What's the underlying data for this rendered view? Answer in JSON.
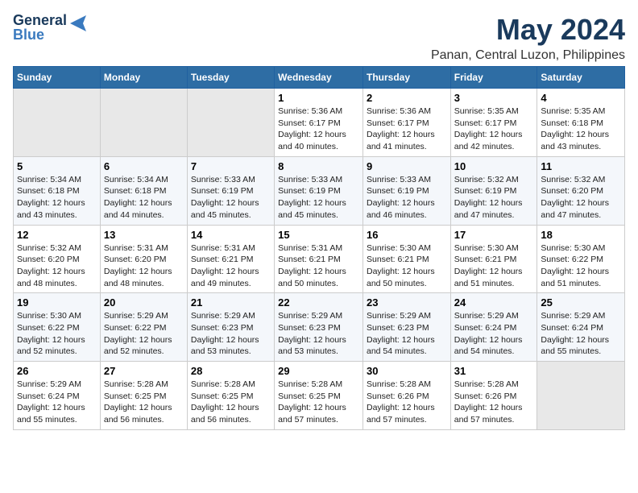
{
  "logo": {
    "line1": "General",
    "line2": "Blue"
  },
  "title": "May 2024",
  "subtitle": "Panan, Central Luzon, Philippines",
  "days_header": [
    "Sunday",
    "Monday",
    "Tuesday",
    "Wednesday",
    "Thursday",
    "Friday",
    "Saturday"
  ],
  "weeks": [
    [
      {
        "num": "",
        "info": ""
      },
      {
        "num": "",
        "info": ""
      },
      {
        "num": "",
        "info": ""
      },
      {
        "num": "1",
        "info": "Sunrise: 5:36 AM\nSunset: 6:17 PM\nDaylight: 12 hours\nand 40 minutes."
      },
      {
        "num": "2",
        "info": "Sunrise: 5:36 AM\nSunset: 6:17 PM\nDaylight: 12 hours\nand 41 minutes."
      },
      {
        "num": "3",
        "info": "Sunrise: 5:35 AM\nSunset: 6:17 PM\nDaylight: 12 hours\nand 42 minutes."
      },
      {
        "num": "4",
        "info": "Sunrise: 5:35 AM\nSunset: 6:18 PM\nDaylight: 12 hours\nand 43 minutes."
      }
    ],
    [
      {
        "num": "5",
        "info": "Sunrise: 5:34 AM\nSunset: 6:18 PM\nDaylight: 12 hours\nand 43 minutes."
      },
      {
        "num": "6",
        "info": "Sunrise: 5:34 AM\nSunset: 6:18 PM\nDaylight: 12 hours\nand 44 minutes."
      },
      {
        "num": "7",
        "info": "Sunrise: 5:33 AM\nSunset: 6:19 PM\nDaylight: 12 hours\nand 45 minutes."
      },
      {
        "num": "8",
        "info": "Sunrise: 5:33 AM\nSunset: 6:19 PM\nDaylight: 12 hours\nand 45 minutes."
      },
      {
        "num": "9",
        "info": "Sunrise: 5:33 AM\nSunset: 6:19 PM\nDaylight: 12 hours\nand 46 minutes."
      },
      {
        "num": "10",
        "info": "Sunrise: 5:32 AM\nSunset: 6:19 PM\nDaylight: 12 hours\nand 47 minutes."
      },
      {
        "num": "11",
        "info": "Sunrise: 5:32 AM\nSunset: 6:20 PM\nDaylight: 12 hours\nand 47 minutes."
      }
    ],
    [
      {
        "num": "12",
        "info": "Sunrise: 5:32 AM\nSunset: 6:20 PM\nDaylight: 12 hours\nand 48 minutes."
      },
      {
        "num": "13",
        "info": "Sunrise: 5:31 AM\nSunset: 6:20 PM\nDaylight: 12 hours\nand 48 minutes."
      },
      {
        "num": "14",
        "info": "Sunrise: 5:31 AM\nSunset: 6:21 PM\nDaylight: 12 hours\nand 49 minutes."
      },
      {
        "num": "15",
        "info": "Sunrise: 5:31 AM\nSunset: 6:21 PM\nDaylight: 12 hours\nand 50 minutes."
      },
      {
        "num": "16",
        "info": "Sunrise: 5:30 AM\nSunset: 6:21 PM\nDaylight: 12 hours\nand 50 minutes."
      },
      {
        "num": "17",
        "info": "Sunrise: 5:30 AM\nSunset: 6:21 PM\nDaylight: 12 hours\nand 51 minutes."
      },
      {
        "num": "18",
        "info": "Sunrise: 5:30 AM\nSunset: 6:22 PM\nDaylight: 12 hours\nand 51 minutes."
      }
    ],
    [
      {
        "num": "19",
        "info": "Sunrise: 5:30 AM\nSunset: 6:22 PM\nDaylight: 12 hours\nand 52 minutes."
      },
      {
        "num": "20",
        "info": "Sunrise: 5:29 AM\nSunset: 6:22 PM\nDaylight: 12 hours\nand 52 minutes."
      },
      {
        "num": "21",
        "info": "Sunrise: 5:29 AM\nSunset: 6:23 PM\nDaylight: 12 hours\nand 53 minutes."
      },
      {
        "num": "22",
        "info": "Sunrise: 5:29 AM\nSunset: 6:23 PM\nDaylight: 12 hours\nand 53 minutes."
      },
      {
        "num": "23",
        "info": "Sunrise: 5:29 AM\nSunset: 6:23 PM\nDaylight: 12 hours\nand 54 minutes."
      },
      {
        "num": "24",
        "info": "Sunrise: 5:29 AM\nSunset: 6:24 PM\nDaylight: 12 hours\nand 54 minutes."
      },
      {
        "num": "25",
        "info": "Sunrise: 5:29 AM\nSunset: 6:24 PM\nDaylight: 12 hours\nand 55 minutes."
      }
    ],
    [
      {
        "num": "26",
        "info": "Sunrise: 5:29 AM\nSunset: 6:24 PM\nDaylight: 12 hours\nand 55 minutes."
      },
      {
        "num": "27",
        "info": "Sunrise: 5:28 AM\nSunset: 6:25 PM\nDaylight: 12 hours\nand 56 minutes."
      },
      {
        "num": "28",
        "info": "Sunrise: 5:28 AM\nSunset: 6:25 PM\nDaylight: 12 hours\nand 56 minutes."
      },
      {
        "num": "29",
        "info": "Sunrise: 5:28 AM\nSunset: 6:25 PM\nDaylight: 12 hours\nand 57 minutes."
      },
      {
        "num": "30",
        "info": "Sunrise: 5:28 AM\nSunset: 6:26 PM\nDaylight: 12 hours\nand 57 minutes."
      },
      {
        "num": "31",
        "info": "Sunrise: 5:28 AM\nSunset: 6:26 PM\nDaylight: 12 hours\nand 57 minutes."
      },
      {
        "num": "",
        "info": ""
      }
    ]
  ]
}
